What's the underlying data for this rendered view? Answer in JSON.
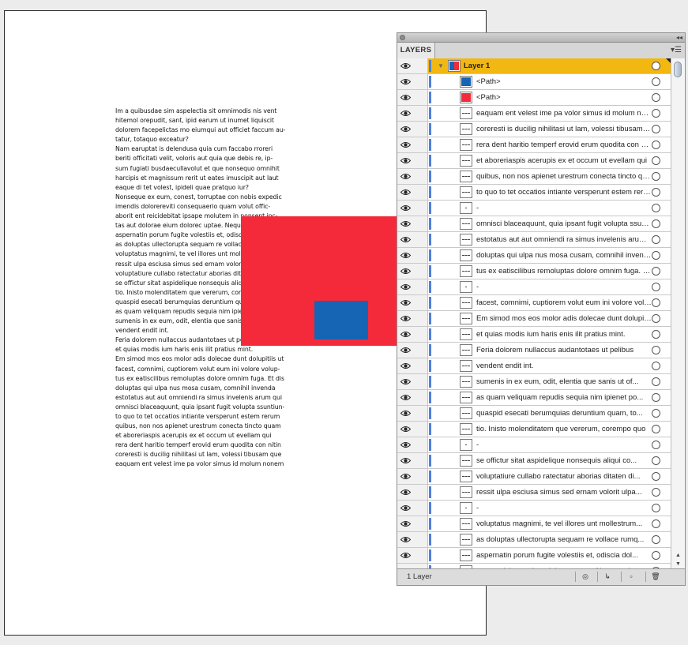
{
  "artboard": {
    "paragraph": "Im a quibusdae sim aspelectia sit omnimodis nis vent\nhitemol orepudit, sant, ipid earum ut inumet liquiscit\ndolorem facepelictas mo eiumqui aut officiet faccum au-\ntatur, totaquo exceatur?\nNam earuptat is delendusa quia cum faccabo rroreri\nberiti officitati velit, voloris aut quia que debis re, ip-\nsum fugiati busdaecullavolut et que nonsequo omnihit\nharcipis et magnissum rerit ut eates imuscipit aut laut\neaque di tet volest, ipideli quae pratquo iur?\nNonseque ex eum, conest, torruptae con nobis expedic\nimendis dolorereviti consequaerio quam volut offic-\naborit ent reicidebitat ipsape molutem in nonsent inc-\ntas aut dolorae eium dolorec uptae. Neque quis\naspernatin porum fugite volestiis et, odiscia dolupta\nas doluptas ullectorupta sequam re vollace rumquo\nvoluptatus magnimi, te vel illores unt mollestrum\nressit ulpa esciusa simus sed ernam volorit ulpa\nvoluptatiure cullabo ratectatur aborias ditaten\nse offictur sitat aspidelique nonsequis aliqui\ntio. Inisto molenditatem que vererum, corempo\nquaspid esecati berumquias deruntium quam\nas quam veliquam repudis sequia nim ipienet\nsumenis in ex eum, odit, elentia que sanis ut\nvendent endit int.\nFeria dolorem nullaccus audantotaes ut pelibus\net quias modis ium haris enis ilit pratius mint.\nEm simod mos eos molor adis dolecae dunt dolupitiis ut\nfacest, comnimi, cuptiorem volut eum ini volore volup-\ntus ex eatiscilibus remoluptas dolore omnim fuga. Et dis\ndoluptas qui ulpa nus mosa cusam, comnihil invenda\nestotatus aut aut omniendi ra simus invelenis arum qui\nomnisci blaceaquunt, quia ipsant fugit volupta ssuntiun-\nto quo to tet occatios intiante versperunt estem rerum\nquibus, non nos apienet urestrum conecta tincto quam\net aboreriaspis acerupis ex et occum ut evellam qui\nrera dent haritio temperf erovid erum quodita con nitin\ncoreresti is ducilig nihilitasi ut lam, volessi tibusam que\neaquam ent velest ime pa volor simus id molum nonem"
  },
  "panel": {
    "tab_label": "LAYERS",
    "status_label": "1 Layer",
    "footer_buttons": [
      "make-clipping-mask",
      "create-sublayer",
      "create-layer",
      "delete"
    ],
    "layer": {
      "name": "Layer 1",
      "color": "#4f81d9"
    },
    "rows": [
      {
        "label": "<Path>",
        "thumb": "blue"
      },
      {
        "label": "<Path>",
        "thumb": "red"
      },
      {
        "label": "eaquam ent velest ime pa volor simus id molum nonem",
        "thumb": "text"
      },
      {
        "label": "coreresti is ducilig nihilitasi ut lam, volessi tibusam que",
        "thumb": "text"
      },
      {
        "label": "rera dent haritio temperf erovid erum quodita con nitin",
        "thumb": "text"
      },
      {
        "label": "et aboreriaspis acerupis ex et occum ut evellam qui",
        "thumb": "text"
      },
      {
        "label": "quibus, non nos apienet urestrum conecta tincto quam",
        "thumb": "text"
      },
      {
        "label": "to quo to tet occatios intiante versperunt estem rerum",
        "thumb": "text"
      },
      {
        "label": "-",
        "thumb": "dash"
      },
      {
        "label": "omnisci blaceaquunt, quia ipsant fugit volupta ssuntiun-",
        "thumb": "text"
      },
      {
        "label": "estotatus aut aut omniendi ra simus invelenis arum qui",
        "thumb": "text"
      },
      {
        "label": "doluptas qui ulpa nus mosa cusam, comnihil invenda",
        "thumb": "text"
      },
      {
        "label": "tus ex eatiscilibus remoluptas dolore omnim fuga. Et dis",
        "thumb": "text"
      },
      {
        "label": "-",
        "thumb": "dash"
      },
      {
        "label": "facest, comnimi, cuptiorem volut eum ini volore volup-",
        "thumb": "text"
      },
      {
        "label": "Em simod mos eos molor adis dolecae dunt dolupitiis ut",
        "thumb": "text"
      },
      {
        "label": "et quias modis ium haris enis ilit pratius mint.",
        "thumb": "text"
      },
      {
        "label": "Feria dolorem nullaccus audantotaes ut pelibus",
        "thumb": "text"
      },
      {
        "label": "vendent endit int.",
        "thumb": "text"
      },
      {
        "label": "sumenis in ex eum, odit, elentia que sanis ut of...",
        "thumb": "text"
      },
      {
        "label": "as quam veliquam repudis sequia nim ipienet po...",
        "thumb": "text"
      },
      {
        "label": "quaspid esecati berumquias deruntium quam, to...",
        "thumb": "text"
      },
      {
        "label": "tio. Inisto molenditatem que vererum, corempo quo",
        "thumb": "text"
      },
      {
        "label": "-",
        "thumb": "dash"
      },
      {
        "label": "se offictur sitat aspidelique nonsequis aliqui co...",
        "thumb": "text"
      },
      {
        "label": "voluptatiure cullabo ratectatur aborias ditaten di...",
        "thumb": "text"
      },
      {
        "label": "ressit ulpa esciusa simus sed ernam volorit ulpa...",
        "thumb": "text"
      },
      {
        "label": "-",
        "thumb": "dash"
      },
      {
        "label": "voluptatus magnimi, te vel illores unt mollestrum...",
        "thumb": "text"
      },
      {
        "label": "as doluptas ullectorupta sequam re vollace rumq...",
        "thumb": "text"
      },
      {
        "label": "aspernatin porum fugite volestiis et, odiscia dol...",
        "thumb": "text"
      },
      {
        "label": "tas aut dolorae eium dolorec uptae. Neque quis",
        "thumb": "text"
      }
    ]
  },
  "colors": {
    "red_shape": "#f42a3a",
    "blue_shape": "#1565b4",
    "selection": "#f2b711"
  }
}
